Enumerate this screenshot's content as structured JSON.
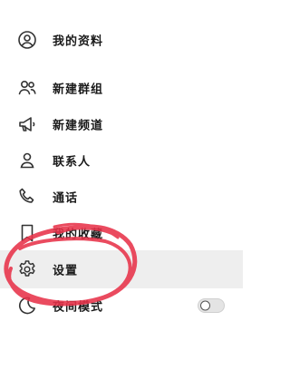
{
  "menu": {
    "top_fragment": "",
    "items": [
      {
        "label": "我的资料",
        "icon": "person-circle-icon"
      },
      {
        "label": "新建群组",
        "icon": "people-icon"
      },
      {
        "label": "新建频道",
        "icon": "megaphone-icon"
      },
      {
        "label": "联系人",
        "icon": "person-icon"
      },
      {
        "label": "通话",
        "icon": "phone-icon"
      },
      {
        "label": "我的收藏",
        "icon": "bookmark-icon"
      },
      {
        "label": "设置",
        "icon": "gear-icon"
      },
      {
        "label": "夜间模式",
        "icon": "moon-icon"
      }
    ],
    "night_mode_enabled": false
  },
  "colors": {
    "icon": "#333333",
    "text": "#1a1a1a",
    "selected_background": "#eeeeee",
    "annotation": "#e8334a"
  }
}
